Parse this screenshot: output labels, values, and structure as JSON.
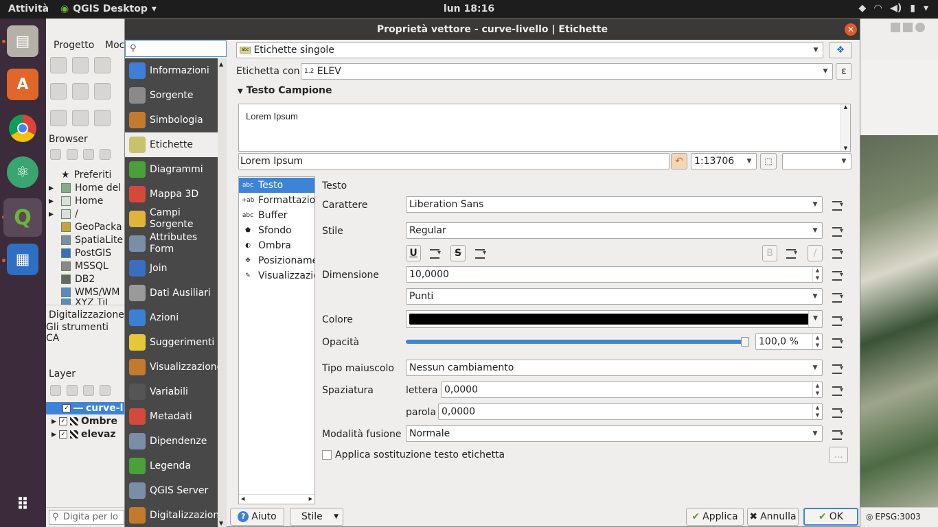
{
  "topbar": {
    "activities": "Attività",
    "app_name": "QGIS Desktop",
    "clock": "lun 18:16"
  },
  "bg_window": {
    "menu": [
      "Progetto",
      "Moc"
    ],
    "browser_title": "Browser",
    "browser_items": [
      "Preferiti",
      "Home del",
      "Home",
      "/",
      "GeoPacka",
      "SpatiaLite",
      "PostGIS",
      "MSSQL",
      "DB2",
      "WMS/WM",
      "XYZ Til"
    ],
    "digit_title": "Digitalizzazione",
    "digit_sub": "Gli strumenti CA",
    "layer_title": "Layer",
    "layers": [
      "curve-l",
      "Ombre",
      "elevaz"
    ],
    "search_placeholder": "Digita per lo",
    "epsg": "EPSG:3003"
  },
  "dialog": {
    "title": "Proprietà vettore - curve-livello | Etichette",
    "sidebar": [
      {
        "label": "Informazioni",
        "icon": "info-icon",
        "color": "#3d7fd6"
      },
      {
        "label": "Sorgente",
        "icon": "wrench-icon",
        "color": "#8a8a8a"
      },
      {
        "label": "Simbologia",
        "icon": "brush-icon",
        "color": "#c47a2c"
      },
      {
        "label": "Etichette",
        "icon": "label-abc-icon",
        "color": "#c9c26a"
      },
      {
        "label": "Diagrammi",
        "icon": "diagram-icon",
        "color": "#4aa13a"
      },
      {
        "label": "Mappa 3D",
        "icon": "cube-icon",
        "color": "#d44a3a"
      },
      {
        "label": "Campi Sorgente",
        "icon": "fields-icon",
        "color": "#e0b43a"
      },
      {
        "label": "Attributes Form",
        "icon": "form-icon",
        "color": "#7a8ea8"
      },
      {
        "label": "Join",
        "icon": "join-icon",
        "color": "#3a6fc0"
      },
      {
        "label": "Dati Ausiliari",
        "icon": "database-icon",
        "color": "#9a9a9a"
      },
      {
        "label": "Azioni",
        "icon": "gear-action-icon",
        "color": "#3d7fd6"
      },
      {
        "label": "Suggerimenti",
        "icon": "speech-bubble-icon",
        "color": "#e5c83a"
      },
      {
        "label": "Visualizzazione",
        "icon": "paintbrush-icon",
        "color": "#c47a2c"
      },
      {
        "label": "Variabili",
        "icon": "epsilon-icon",
        "color": "#555"
      },
      {
        "label": "Metadati",
        "icon": "metadata-icon",
        "color": "#d44a3a"
      },
      {
        "label": "Dipendenze",
        "icon": "dependencies-icon",
        "color": "#7a8ea8"
      },
      {
        "label": "Legenda",
        "icon": "legend-icon",
        "color": "#4aa13a"
      },
      {
        "label": "QGIS Server",
        "icon": "server-icon",
        "color": "#7a8ea8"
      },
      {
        "label": "Digitalizzazion",
        "icon": "digitize-icon",
        "color": "#c47a2c"
      }
    ],
    "mode_combo": "Etichette singole",
    "label_with": "Etichetta con",
    "label_field_prefix": "1.2",
    "label_field": "ELEV",
    "sample_section": "Testo Campione",
    "sample_text": "Lorem Ipsum",
    "sample_input": "Lorem Ipsum",
    "scale": "1:13706",
    "subtabs": [
      {
        "label": "Testo",
        "icon": "abc"
      },
      {
        "label": "Formattazio",
        "icon": "+ab"
      },
      {
        "label": "Buffer",
        "icon": "abc"
      },
      {
        "label": "Sfondo",
        "icon": "shield"
      },
      {
        "label": "Ombra",
        "icon": "shadow"
      },
      {
        "label": "Posizioname",
        "icon": "move"
      },
      {
        "label": "Visualizzazio",
        "icon": "brush"
      }
    ],
    "text_section": "Testo",
    "font_label": "Carattere",
    "font_value": "Liberation Sans",
    "style_label": "Stile",
    "style_value": "Regular",
    "underline": "U",
    "strike": "S",
    "bold": "B",
    "italic": "/",
    "size_label": "Dimensione",
    "size_value": "10,0000",
    "unit_value": "Punti",
    "color_label": "Colore",
    "color_value": "#000000",
    "opacity_label": "Opacità",
    "opacity_value": "100,0 %",
    "opacity_fraction": 1.0,
    "case_label": "Tipo maiuscolo",
    "case_value": "Nessun cambiamento",
    "spacing_label": "Spaziatura",
    "letter_label": "lettera",
    "letter_value": "0,0000",
    "word_label": "parola",
    "word_value": "0,0000",
    "blend_label": "Modalità fusione",
    "blend_value": "Normale",
    "substitute_label": "Applica sostituzione testo etichetta",
    "substitute_btn": "...",
    "help_btn": "Aiuto",
    "style_btn": "Stile",
    "apply_btn": "Applica",
    "cancel_btn": "Annulla",
    "ok_btn": "OK"
  }
}
